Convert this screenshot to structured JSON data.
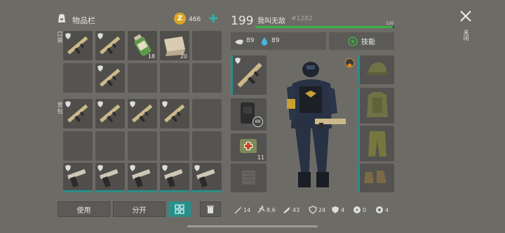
{
  "inventory": {
    "title": "物品栏",
    "coins": "466",
    "pocket_label": "口袋",
    "backpack_label": "背包",
    "pocket_cells": [
      {
        "item": "rifle-icon",
        "qty": ""
      },
      {
        "item": "rifle-icon",
        "qty": ""
      },
      {
        "item": "canteen-icon",
        "qty": "18"
      },
      {
        "item": "cloth-icon",
        "qty": "20"
      },
      {
        "item": "",
        "qty": ""
      },
      {
        "item": "",
        "qty": ""
      },
      {
        "item": "rifle-icon",
        "qty": ""
      },
      {
        "item": "",
        "qty": ""
      },
      {
        "item": "",
        "qty": ""
      },
      {
        "item": "",
        "qty": ""
      }
    ],
    "use_button": "使用",
    "split_button": "分开"
  },
  "player": {
    "level": "199",
    "name": "我叫无敌",
    "id": "#1282",
    "xp_max": "120",
    "xp_fraction": 0.99,
    "food": "89",
    "water": "89",
    "skills_label": "技能",
    "equip_qty_medkit": "11",
    "equip_badge_armor": "88"
  },
  "stats": {
    "melee": "14",
    "speed": "8.6",
    "attack": "43",
    "defense": "24",
    "cold": "4",
    "radiation": "0",
    "bio": "4"
  },
  "close": {
    "label": "关闭"
  },
  "colors": {
    "accent": "#2a8f8a",
    "xp_bar": "#3fb046",
    "coin": "#d9a626",
    "plus": "#2fb3a9"
  }
}
